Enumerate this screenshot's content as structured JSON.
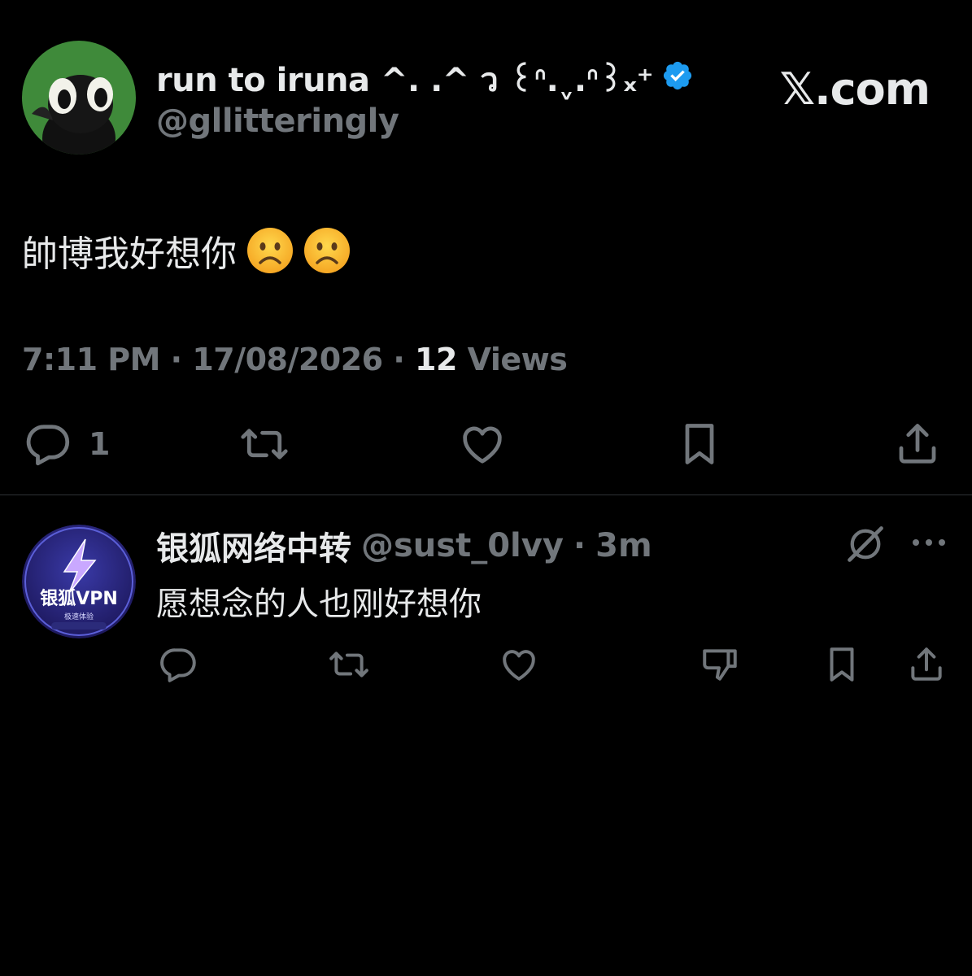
{
  "tweet": {
    "author": {
      "display_name": "run to iruna ^. .^ ว ꒰ᐢ.ˬ.ᐢ꒱ₓ⁺",
      "handle": "@gllitteringly",
      "verified": true
    },
    "brand": "𝕏.com",
    "text": "帥博我好想你",
    "emoji": [
      "frowning-face",
      "frowning-face"
    ],
    "meta": {
      "time": "7:11 PM",
      "date": "17/08/2026",
      "views_count": "12",
      "views_label": "Views",
      "separator": "·"
    },
    "actions": {
      "reply_count": "1"
    }
  },
  "reply": {
    "display_name": "银狐网络中转",
    "handle": "@sust_0lvy",
    "separator": "·",
    "time": "3m",
    "text": "愿想念的人也刚好想你",
    "avatar_label": "银狐VPN",
    "avatar_sublabel": "极速体验"
  },
  "colors": {
    "background": "#000000",
    "text_primary": "#e7e9ea",
    "text_secondary": "#71767b",
    "verified_blue": "#1d9bf0",
    "divider": "#2f3336"
  }
}
